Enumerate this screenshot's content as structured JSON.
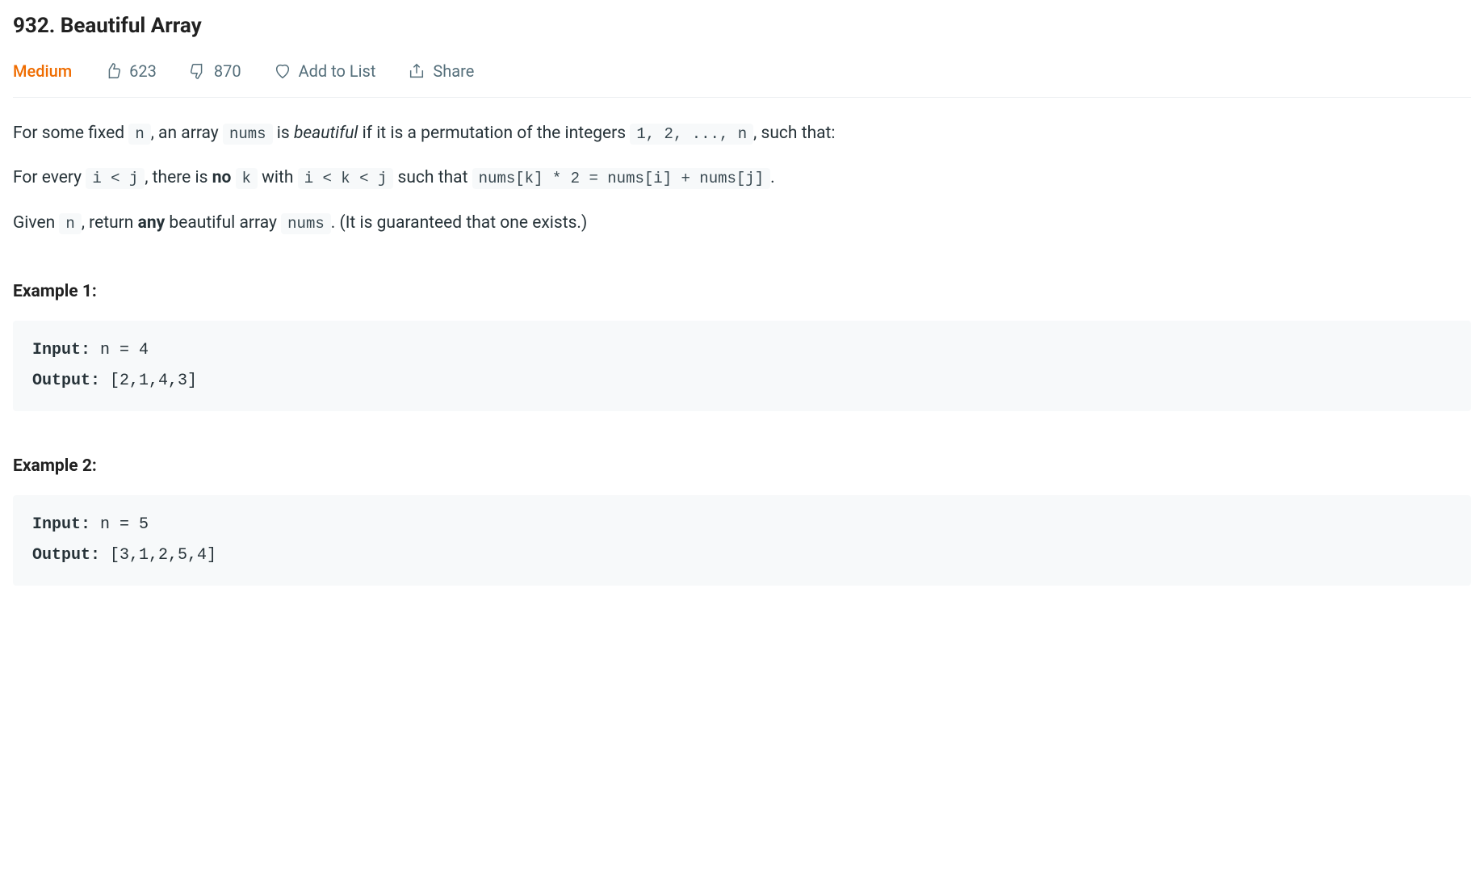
{
  "title": "932. Beautiful Array",
  "difficulty": "Medium",
  "likes": "623",
  "dislikes": "870",
  "add_to_list": "Add to List",
  "share": "Share",
  "description": {
    "p1_a": "For some fixed ",
    "p1_code1": "n",
    "p1_b": ", an array ",
    "p1_code2": "nums",
    "p1_c": " is ",
    "p1_italic": "beautiful",
    "p1_d": " if it is a permutation of the integers ",
    "p1_code3": "1, 2, ..., n",
    "p1_e": ", such that:",
    "p2_a": "For every ",
    "p2_code1": "i < j",
    "p2_b": ", there is ",
    "p2_bold": "no",
    "p2_c": " ",
    "p2_code2": "k",
    "p2_d": " with ",
    "p2_code3": "i < k < j",
    "p2_e": " such that ",
    "p2_code4": "nums[k] * 2 = nums[i] + nums[j]",
    "p2_f": ".",
    "p3_a": "Given ",
    "p3_code1": "n",
    "p3_b": ", return ",
    "p3_bold": "any",
    "p3_c": " beautiful array ",
    "p3_code2": "nums",
    "p3_d": ".  (It is guaranteed that one exists.)"
  },
  "examples": [
    {
      "heading": "Example 1:",
      "input_label": "Input:",
      "input_value": " n = 4",
      "output_label": "Output:",
      "output_value": " [2,1,4,3]"
    },
    {
      "heading": "Example 2:",
      "input_label": "Input:",
      "input_value": " n = 5",
      "output_label": "Output:",
      "output_value": " [3,1,2,5,4]"
    }
  ]
}
